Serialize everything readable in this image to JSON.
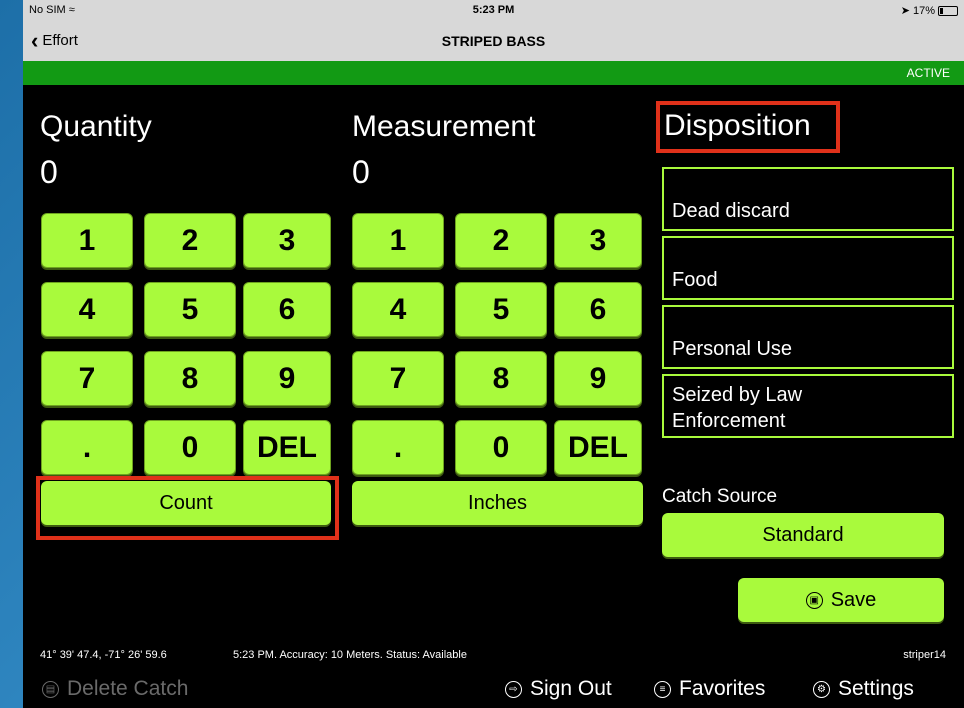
{
  "status": {
    "carrier": "No SIM",
    "time": "5:23 PM",
    "battery": "17%"
  },
  "nav": {
    "back_label": "Effort",
    "title": "STRIPED BASS"
  },
  "state": {
    "label": "ACTIVE"
  },
  "quantity": {
    "heading": "Quantity",
    "value": "0",
    "keys": [
      "1",
      "2",
      "3",
      "4",
      "5",
      "6",
      "7",
      "8",
      "9",
      ".",
      "0",
      "DEL"
    ],
    "unit_button": "Count"
  },
  "measurement": {
    "heading": "Measurement",
    "value": "0",
    "keys": [
      "1",
      "2",
      "3",
      "4",
      "5",
      "6",
      "7",
      "8",
      "9",
      ".",
      "0",
      "DEL"
    ],
    "unit_button": "Inches"
  },
  "disposition": {
    "heading": "Disposition",
    "options": [
      "Dead discard",
      "Food",
      "Personal Use"
    ],
    "option4_line1": "Seized by Law",
    "option4_line2": "Enforcement"
  },
  "catch_source": {
    "label": "Catch Source",
    "value": "Standard"
  },
  "save_label": "Save",
  "footer": {
    "coords": "41° 39' 47.4,  -71° 26' 59.6",
    "info": "5:23 PM.   Accuracy: 10 Meters.   Status: Available",
    "user": "striper14"
  },
  "bottom": {
    "delete": "Delete Catch",
    "signout": "Sign Out",
    "favorites": "Favorites",
    "settings": "Settings"
  },
  "colors": {
    "accent": "#a9fa3c",
    "active_bar": "#129a14",
    "highlight": "#e0311a"
  }
}
